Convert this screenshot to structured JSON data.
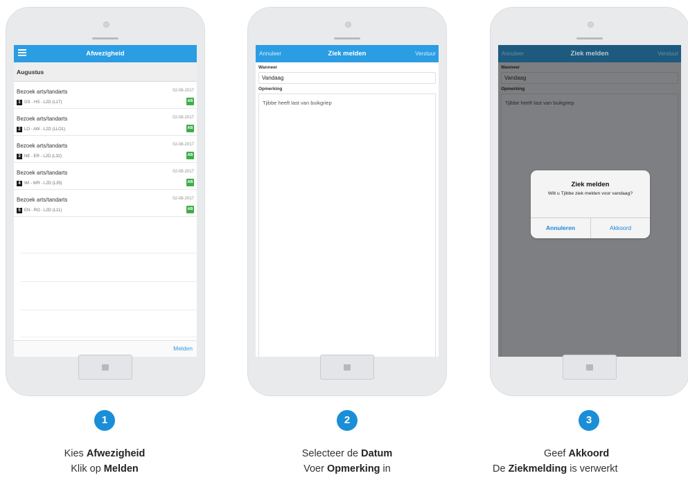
{
  "screen1": {
    "title": "Afwezigheid",
    "section": "Augustus",
    "rows": [
      {
        "title": "Bezoek arts/tandarts",
        "date": "02-08-2017",
        "num": "1",
        "code": "GS - HS - L2D (L17)",
        "badge": "AB"
      },
      {
        "title": "Bezoek arts/tandarts",
        "date": "02-08-2017",
        "num": "2",
        "code": "LO - AW - L2D (LLO1)",
        "badge": "AB"
      },
      {
        "title": "Bezoek arts/tandarts",
        "date": "02-08-2017",
        "num": "3",
        "code": "NE - ER - L2D (L32)",
        "badge": "AB"
      },
      {
        "title": "Bezoek arts/tandarts",
        "date": "02-08-2017",
        "num": "4",
        "code": "WI - WR - L2D (L35)",
        "badge": "AB"
      },
      {
        "title": "Bezoek arts/tandarts",
        "date": "02-08-2017",
        "num": "5",
        "code": "EN - RO - L2D (L11)",
        "badge": "AB"
      }
    ],
    "action": "Melden"
  },
  "screen2": {
    "left": "Annuleer",
    "title": "Ziek melden",
    "right": "Verstuur",
    "when_label": "Wanneer",
    "when_value": "Vandaag",
    "remark_label": "Opmerking",
    "remark_value": "Tjibbe heeft last van buikgriep"
  },
  "screen3": {
    "left": "Annuleer",
    "title": "Ziek melden",
    "right": "Verstuur",
    "when_label": "Wanneer",
    "when_value": "Vandaag",
    "remark_label": "Opmerking",
    "remark_value": "Tjibbe heeft last van buikgriep",
    "dialog": {
      "title": "Ziek melden",
      "message": "Wilt u Tjibbe ziek melden voor vandaag?",
      "cancel": "Annuleren",
      "ok": "Akkoord"
    }
  },
  "steps": [
    {
      "number": "1",
      "l1_pre": "Kies ",
      "l1_bold": "Afwezigheid",
      "l1_post": "",
      "l2_pre": "Klik op  ",
      "l2_bold": "Melden",
      "l2_post": ""
    },
    {
      "number": "2",
      "l1_pre": "Selecteer de ",
      "l1_bold": "Datum",
      "l1_post": "",
      "l2_pre": "Voer ",
      "l2_bold": "Opmerking",
      "l2_post": " in"
    },
    {
      "number": "3",
      "l1_pre": "Geef ",
      "l1_bold": "Akkoord",
      "l1_post": "",
      "l2_pre": "De ",
      "l2_bold": "Ziekmelding",
      "l2_post": " is verwerkt"
    }
  ],
  "colors": {
    "accent": "#2a9de3",
    "badge_green": "#3fae4a",
    "step_blue": "#1b8ed8"
  }
}
